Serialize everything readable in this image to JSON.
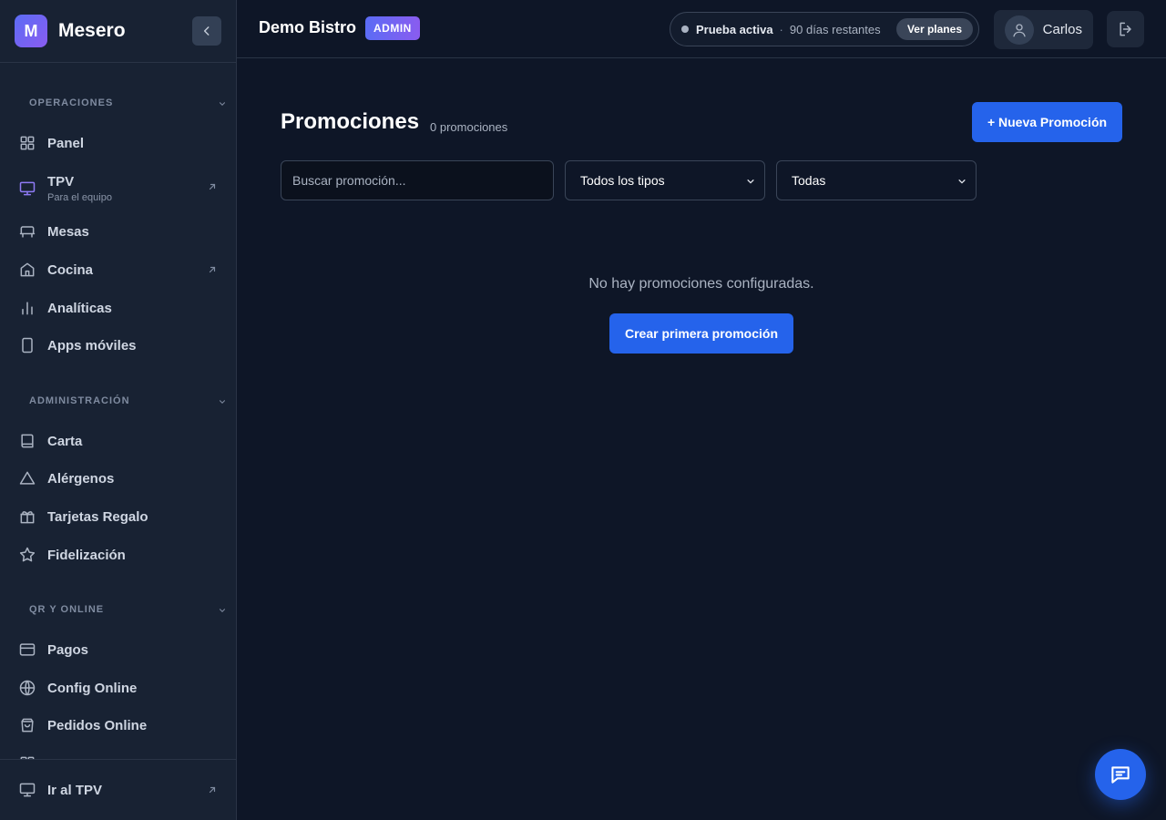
{
  "app": {
    "logo_letter": "M",
    "brand": "Mesero",
    "restaurant": "Demo Bistro",
    "role_badge": "ADMIN"
  },
  "trial": {
    "status": "Prueba activa",
    "separator": "·",
    "days": "90 días restantes",
    "plans_button": "Ver planes"
  },
  "user": {
    "name": "Carlos"
  },
  "sidebar": {
    "sections": [
      {
        "title": "OPERACIONES",
        "items": [
          {
            "label": "Panel",
            "icon": "grid-icon"
          },
          {
            "label": "TPV",
            "sub": "Para el equipo",
            "icon": "monitor-icon",
            "external": true
          },
          {
            "label": "Mesas",
            "icon": "table-icon"
          },
          {
            "label": "Cocina",
            "icon": "home-icon",
            "external": true
          },
          {
            "label": "Analíticas",
            "icon": "bar-chart-icon"
          },
          {
            "label": "Apps móviles",
            "icon": "smartphone-icon"
          }
        ]
      },
      {
        "title": "ADMINISTRACIÓN",
        "items": [
          {
            "label": "Carta",
            "icon": "book-icon"
          },
          {
            "label": "Alérgenos",
            "icon": "warning-icon"
          },
          {
            "label": "Tarjetas Regalo",
            "icon": "gift-icon"
          },
          {
            "label": "Fidelización",
            "icon": "star-icon"
          }
        ]
      },
      {
        "title": "QR Y ONLINE",
        "items": [
          {
            "label": "Pagos",
            "icon": "credit-card-icon"
          },
          {
            "label": "Config Online",
            "icon": "globe-icon"
          },
          {
            "label": "Pedidos Online",
            "icon": "shopping-bag-icon"
          }
        ]
      }
    ],
    "footer": {
      "label": "Ir al TPV",
      "icon": "monitor-icon"
    }
  },
  "main": {
    "title": "Promociones",
    "count": "0 promociones",
    "new_button": "+ Nueva Promoción",
    "search_placeholder": "Buscar promoción...",
    "type_filter": "Todos los tipos",
    "status_filter": "Todas",
    "empty_message": "No hay promociones configuradas.",
    "create_button": "Crear primera promoción"
  },
  "colors": {
    "primary": "#2563eb",
    "sidebar_bg": "#182233",
    "main_bg": "#0e1627",
    "accent_gradient_start": "#5b6cf5",
    "accent_gradient_end": "#8a5cf0"
  }
}
